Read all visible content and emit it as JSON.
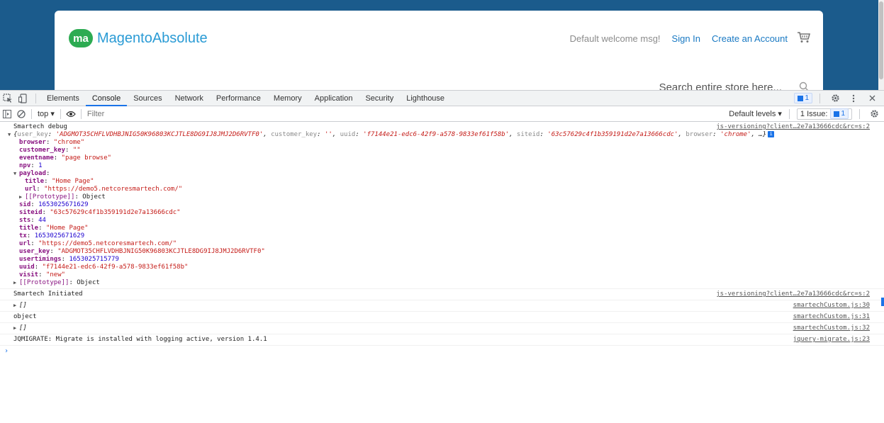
{
  "site": {
    "logo_badge": "ma",
    "logo_name": "MagentoAbsolute",
    "welcome": "Default welcome msg!",
    "sign_in": "Sign In",
    "create_account": "Create an Account",
    "search_placeholder": "Search entire store here..."
  },
  "devtools": {
    "tabs": [
      "Elements",
      "Console",
      "Sources",
      "Network",
      "Performance",
      "Memory",
      "Application",
      "Security",
      "Lighthouse"
    ],
    "active_tab": "Console",
    "message_count": "1",
    "toolbar": {
      "context": "top ▾",
      "filter_placeholder": "Filter",
      "levels": "Default levels ▾",
      "issues_label": "1 Issue:",
      "issues_count": "1"
    }
  },
  "console": {
    "debug_label": "Smartech debug",
    "debug_src": "js-versioning?client…2e7a13666cdc&rc=s:2",
    "preview": {
      "user_key": "'ADGMOT35CHFLVDHBJNIG50K96803KCJTLE8DG9IJ8JMJ2D6RVTF0'",
      "customer_key": "''",
      "uuid": "'f7144e21-edc6-42f9-a578-9833ef61f58b'",
      "siteid": "'63c57629c4f1b359191d2e7a13666cdc'",
      "browser": "'chrome'",
      "tail": "…}"
    },
    "props": [
      {
        "key": "browser",
        "val": "\"chrome\"",
        "type": "s"
      },
      {
        "key": "customer_key",
        "val": "\"\"",
        "type": "s"
      },
      {
        "key": "eventname",
        "val": "\"page browse\"",
        "type": "s"
      },
      {
        "key": "npv",
        "val": "1",
        "type": "n"
      }
    ],
    "payload_key": "payload",
    "payload_props": [
      {
        "key": "title",
        "val": "\"Home Page\"",
        "type": "s"
      },
      {
        "key": "url",
        "val": "\"https://demo5.netcoresmartech.com/\"",
        "type": "s"
      }
    ],
    "prototype_key": "[[Prototype]]",
    "prototype_val": "Object",
    "props2": [
      {
        "key": "sid",
        "val": "1653025671629",
        "type": "n"
      },
      {
        "key": "siteid",
        "val": "\"63c57629c4f1b359191d2e7a13666cdc\"",
        "type": "s"
      },
      {
        "key": "sts",
        "val": "44",
        "type": "n"
      },
      {
        "key": "title",
        "val": "\"Home Page\"",
        "type": "s"
      },
      {
        "key": "tx",
        "val": "1653025671629",
        "type": "n"
      },
      {
        "key": "url",
        "val": "\"https://demo5.netcoresmartech.com/\"",
        "type": "s"
      },
      {
        "key": "user_key",
        "val": "\"ADGMOT35CHFLVDHBJNIG50K96803KCJTLE8DG9IJ8JMJ2D6RVTF0\"",
        "type": "s"
      },
      {
        "key": "usertimings",
        "val": "1653025715779",
        "type": "n"
      },
      {
        "key": "uuid",
        "val": "\"f7144e21-edc6-42f9-a578-9833ef61f58b\"",
        "type": "s"
      },
      {
        "key": "visit",
        "val": "\"new\"",
        "type": "s"
      }
    ],
    "messages": [
      {
        "text": "Smartech Initiated",
        "src": "js-versioning?client…2e7a13666cdc&rc=s:2",
        "expandable": false
      },
      {
        "text": "[]",
        "src": "smartechCustom.js:30",
        "expandable": true
      },
      {
        "text": "object",
        "src": "smartechCustom.js:31",
        "expandable": false
      },
      {
        "text": "[]",
        "src": "smartechCustom.js:32",
        "expandable": true
      },
      {
        "text": "JQMIGRATE: Migrate is installed with logging active, version 1.4.1",
        "src": "jquery-migrate.js:23",
        "expandable": false
      }
    ],
    "prompt": "›"
  }
}
